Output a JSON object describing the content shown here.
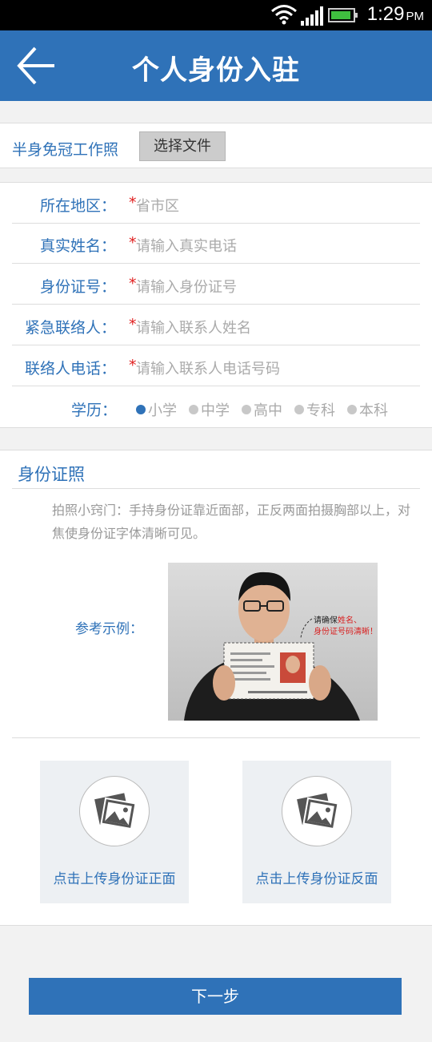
{
  "status_bar": {
    "time": "1:29",
    "ampm": "PM"
  },
  "header": {
    "title": "个人身份入驻"
  },
  "photo_upload": {
    "label": "半身免冠工作照",
    "button": "选择文件"
  },
  "form": {
    "required_mark": "*",
    "fields": [
      {
        "label": "所在地区：",
        "placeholder": "省市区"
      },
      {
        "label": "真实姓名：",
        "placeholder": "请输入真实电话"
      },
      {
        "label": "身份证号：",
        "placeholder": "请输入身份证号"
      },
      {
        "label": "紧急联络人：",
        "placeholder": "请输入联系人姓名"
      },
      {
        "label": "联络人电话：",
        "placeholder": "请输入联系人电话号码"
      }
    ],
    "education": {
      "label": "学历：",
      "options": [
        "小学",
        "中学",
        "高中",
        "专科",
        "本科"
      ],
      "selected": "小学"
    }
  },
  "id_section": {
    "title": "身份证照",
    "tip": "拍照小窍门：手持身份证靠近面部，正反两面拍摄胸部以上，对焦使身份证字体清晰可见。",
    "reference_label": "参考示例：",
    "reference_note_prefix": "请确保",
    "reference_note_highlight1": "姓名、",
    "reference_note_highlight2": "身份证号码清晰！",
    "upload_front": "点击上传身份证正面",
    "upload_back": "点击上传身份证反面"
  },
  "next_button": "下一步",
  "colors": {
    "primary": "#2f72b8",
    "required": "#e02020",
    "placeholder": "#aaaaaa"
  }
}
